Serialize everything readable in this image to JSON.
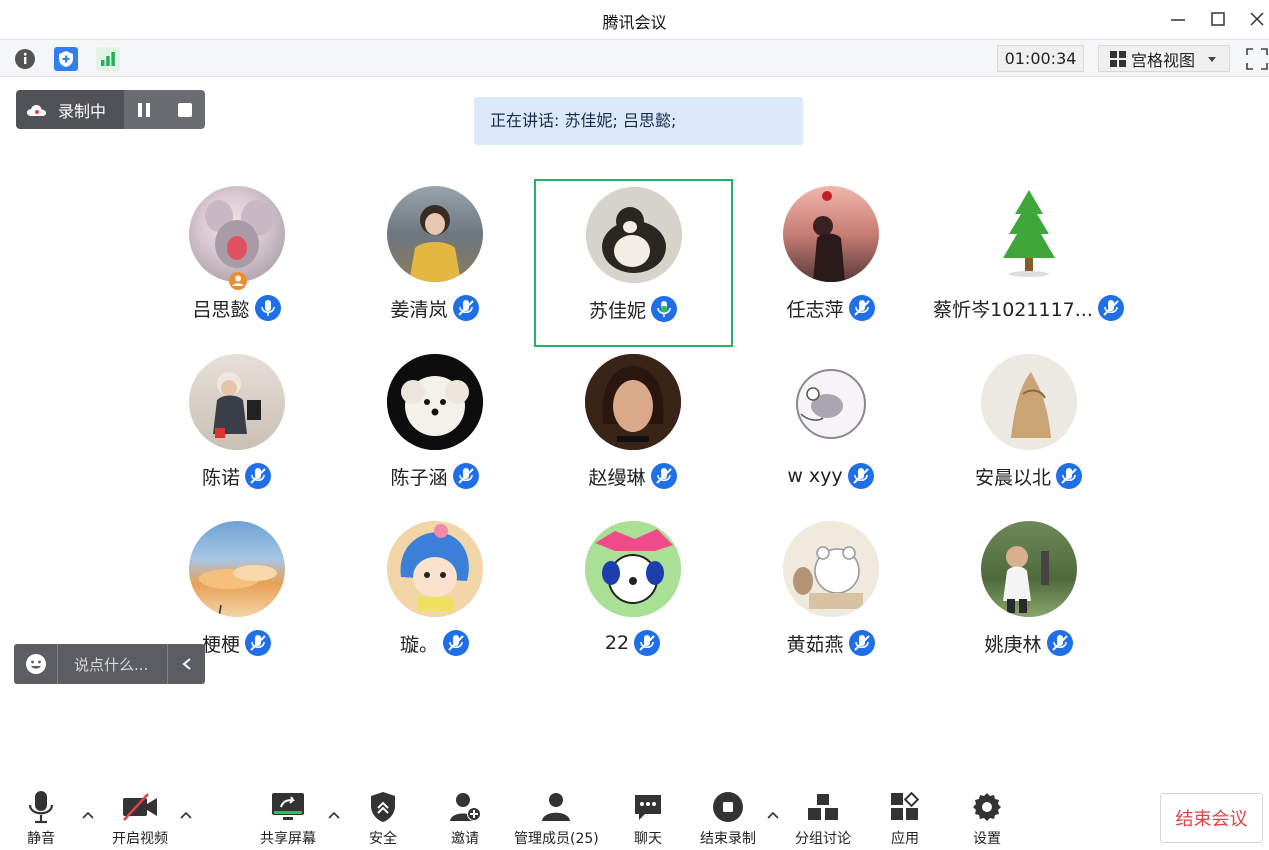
{
  "window": {
    "title": "腾讯会议"
  },
  "toolbar": {
    "timer": "01:00:34",
    "view_label": "宫格视图"
  },
  "recording": {
    "label": "录制中"
  },
  "speaking": {
    "text": "正在讲话: 苏佳妮; 吕思懿;"
  },
  "participants": [
    {
      "name": "吕思懿"
    },
    {
      "name": "姜清岚"
    },
    {
      "name": "苏佳妮"
    },
    {
      "name": "任志萍"
    },
    {
      "name": "蔡忻岑1021117..."
    },
    {
      "name": "陈诺"
    },
    {
      "name": "陈子涵"
    },
    {
      "name": "赵缦琳"
    },
    {
      "name": "w xyy"
    },
    {
      "name": "安晨以北"
    },
    {
      "name": "梗梗"
    },
    {
      "name": "璇。"
    },
    {
      "name": "22"
    },
    {
      "name": "黄茹燕"
    },
    {
      "name": "姚庚林"
    }
  ],
  "chat": {
    "placeholder": "说点什么..."
  },
  "bottom": {
    "mute": "静音",
    "video": "开启视频",
    "share": "共享屏幕",
    "security": "安全",
    "invite": "邀请",
    "manage": "管理成员(25)",
    "chat": "聊天",
    "end_record": "结束录制",
    "breakout": "分组讨论",
    "apps": "应用",
    "settings": "设置",
    "end_meeting": "结束会议"
  },
  "colors": {
    "accent_blue": "#1e6fe8",
    "active_green": "#21b463",
    "end_red": "#e0424a"
  }
}
